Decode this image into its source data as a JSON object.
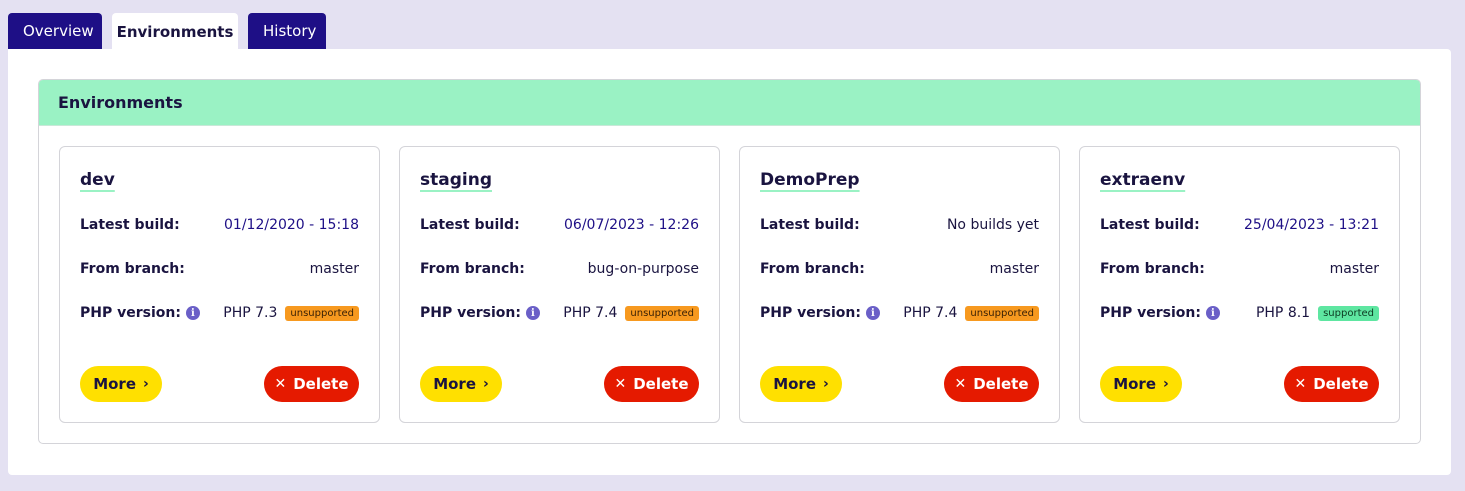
{
  "tabs": [
    {
      "label": "Overview"
    },
    {
      "label": "Environments"
    },
    {
      "label": "History"
    }
  ],
  "section": {
    "title": "Environments"
  },
  "labels": {
    "latest_build": "Latest build:",
    "from_branch": "From branch:",
    "php_version": "PHP version:",
    "more": "More",
    "delete": "Delete"
  },
  "icons": {
    "info": "info-icon",
    "more": "chevron-right-icon",
    "delete": "close-icon"
  },
  "colors": {
    "tab_bg": "#1e0f86",
    "header_bg": "#9af2c4",
    "more_btn": "#ffe000",
    "delete_btn": "#e51a00",
    "badge_unsupported": "#f7991f",
    "badge_supported": "#5ee6a1"
  },
  "environments": [
    {
      "name": "dev",
      "latest_build": "01/12/2020 - 15:18",
      "branch": "master",
      "php": "PHP 7.3",
      "status": "unsupported"
    },
    {
      "name": "staging",
      "latest_build": "06/07/2023 - 12:26",
      "branch": "bug-on-purpose",
      "php": "PHP 7.4",
      "status": "unsupported"
    },
    {
      "name": "DemoPrep",
      "latest_build": "No builds yet",
      "branch": "master",
      "php": "PHP 7.4",
      "status": "unsupported"
    },
    {
      "name": "extraenv",
      "latest_build": "25/04/2023 - 13:21",
      "branch": "master",
      "php": "PHP 8.1",
      "status": "supported"
    }
  ]
}
